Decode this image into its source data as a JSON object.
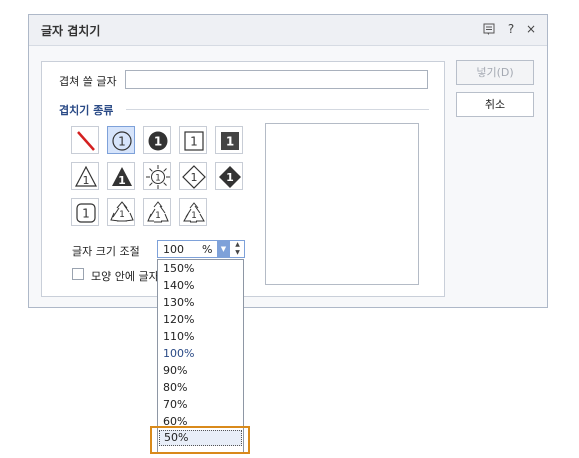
{
  "dialog": {
    "title": "글자 겹치기",
    "titlebar_icons": [
      "help-book-icon",
      "question-icon",
      "close-icon"
    ],
    "help_glyph": "?",
    "close_glyph": "×"
  },
  "form": {
    "overlap_text_label": "겹쳐 쓸 글자",
    "overlap_text_value": "",
    "section_title": "겹치기 종류",
    "size_label": "글자 크기 조절",
    "size_value": "100",
    "size_unit": "%",
    "shape_inside_label": "모양 안에 글자",
    "shape_inside_checked": false
  },
  "buttons": {
    "insert": "넣기(D)",
    "cancel": "취소"
  },
  "shapes": [
    {
      "name": "shape-none",
      "selected": false
    },
    {
      "name": "shape-circle",
      "selected": true
    },
    {
      "name": "shape-filled-circle",
      "selected": false
    },
    {
      "name": "shape-square",
      "selected": false
    },
    {
      "name": "shape-filled-square",
      "selected": false
    },
    {
      "name": "shape-triangle",
      "selected": false
    },
    {
      "name": "shape-filled-triangle",
      "selected": false
    },
    {
      "name": "shape-sun",
      "selected": false
    },
    {
      "name": "shape-diamond",
      "selected": false
    },
    {
      "name": "shape-filled-diamond",
      "selected": false
    },
    {
      "name": "shape-rounded-square",
      "selected": false
    },
    {
      "name": "shape-recycle-1",
      "selected": false
    },
    {
      "name": "shape-recycle-2",
      "selected": false
    },
    {
      "name": "shape-recycle-3",
      "selected": false
    }
  ],
  "size_options": [
    "150%",
    "140%",
    "130%",
    "120%",
    "110%",
    "100%",
    "90%",
    "80%",
    "70%",
    "60%",
    "50%"
  ],
  "size_options_current": "100%",
  "size_options_highlighted": "50%",
  "colors": {
    "accent": "#7ea1d9",
    "section_title": "#2a4a86",
    "highlight_border": "#d98a1b"
  },
  "glyphs": {
    "digit": "1"
  }
}
